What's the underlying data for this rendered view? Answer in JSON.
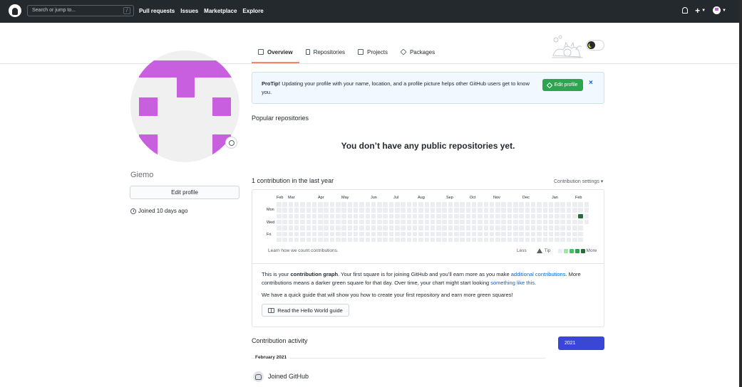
{
  "header": {
    "search_placeholder": "Search or jump to...",
    "search_shortcut": "/",
    "nav": [
      "Pull requests",
      "Issues",
      "Marketplace",
      "Explore"
    ],
    "plus_label": "+"
  },
  "tabs": [
    {
      "label": "Overview",
      "icon": "book-icon",
      "active": true
    },
    {
      "label": "Repositories",
      "icon": "repo-icon",
      "active": false
    },
    {
      "label": "Projects",
      "icon": "project-icon",
      "active": false
    },
    {
      "label": "Packages",
      "icon": "package-icon",
      "active": false
    }
  ],
  "profile": {
    "username": "Giemo",
    "edit_button": "Edit profile",
    "joined": "Joined 10 days ago",
    "avatar_color": "#c85fde"
  },
  "protip": {
    "prefix": "ProTip!",
    "text": " Updating your profile with your name, location, and a profile picture helps other GitHub users get to know you.",
    "button": "Edit profile",
    "close": "×"
  },
  "popular": {
    "title": "Popular repositories",
    "empty": "You don’t have any public repositories yet."
  },
  "contributions": {
    "title": "1 contribution in the last year",
    "settings": "Contribution settings ▾",
    "months": [
      "Feb",
      "Mar",
      "Apr",
      "May",
      "Jun",
      "Jul",
      "Aug",
      "Sep",
      "Oct",
      "Nov",
      "Dec",
      "Jan",
      "Feb"
    ],
    "days": [
      "Mon",
      "Wed",
      "Fri"
    ],
    "weeks": 53,
    "active_cells": [
      {
        "week": 51,
        "day": 2,
        "level": 4
      }
    ],
    "level_colors": [
      "#ebedf0",
      "#9be9a8",
      "#40c463",
      "#30a14e",
      "#216e39"
    ],
    "learn_text": "Learn how we count contributions.",
    "less": "Less",
    "tip": "Tip",
    "more": "More"
  },
  "explain": {
    "p1_a": "This is your ",
    "p1_b": "contribution graph",
    "p1_c": ". Your first square is for joining GitHub and you’ll earn more as you make ",
    "p1_link1": "additional contributions",
    "p1_d": ". More contributions means a darker green square for that day. Over time, your chart might start looking ",
    "p1_link2": "something like this",
    "p1_e": ".",
    "p2": "We have a quick guide that will show you how to create your first repository and earn more green squares!",
    "guide_button": "Read the Hello World guide"
  },
  "activity": {
    "title": "Contribution activity",
    "year": "2021",
    "month_heading": "February 2021",
    "event": "Joined GitHub"
  }
}
